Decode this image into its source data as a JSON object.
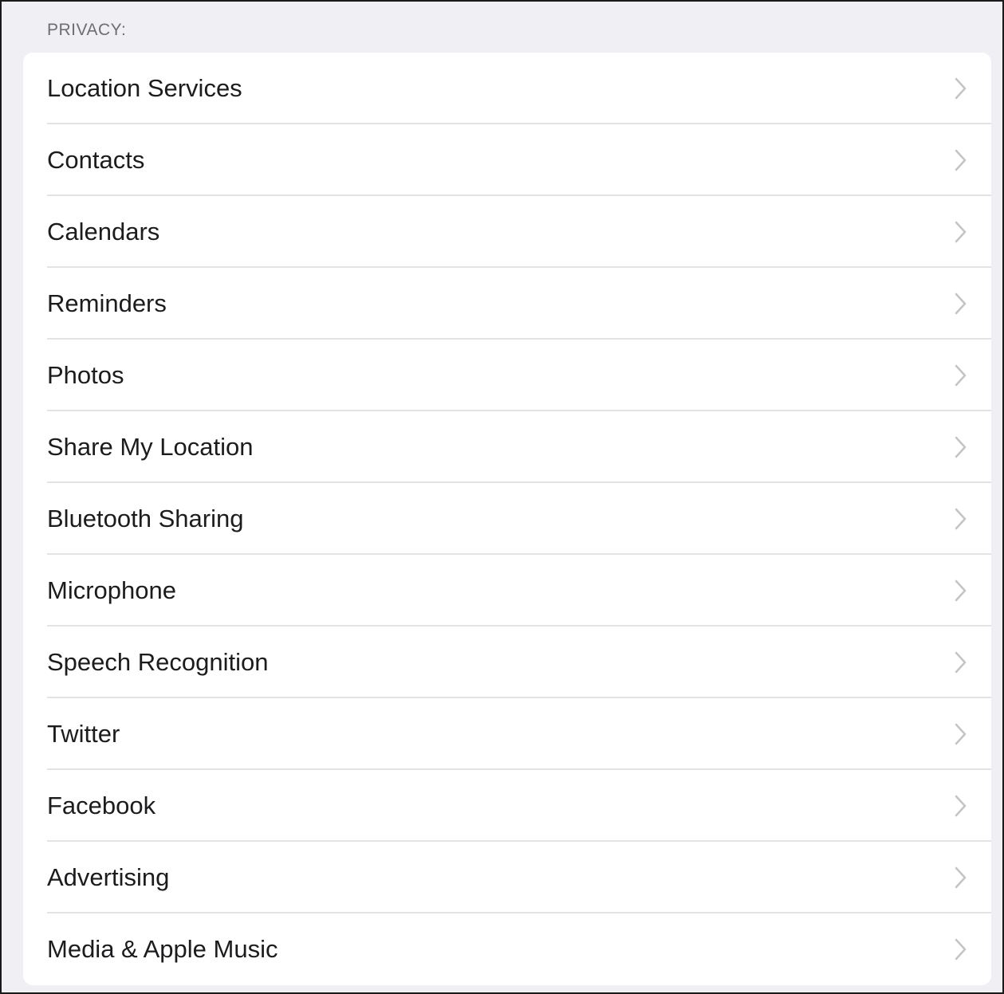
{
  "section": {
    "header": "PRIVACY:"
  },
  "rows": [
    {
      "label": "Location Services",
      "icon": "chevron-right-icon"
    },
    {
      "label": "Contacts",
      "icon": "chevron-right-icon"
    },
    {
      "label": "Calendars",
      "icon": "chevron-right-icon"
    },
    {
      "label": "Reminders",
      "icon": "chevron-right-icon"
    },
    {
      "label": "Photos",
      "icon": "chevron-right-icon"
    },
    {
      "label": "Share My Location",
      "icon": "chevron-right-icon"
    },
    {
      "label": "Bluetooth Sharing",
      "icon": "chevron-right-icon"
    },
    {
      "label": "Microphone",
      "icon": "chevron-right-icon"
    },
    {
      "label": "Speech Recognition",
      "icon": "chevron-right-icon"
    },
    {
      "label": "Twitter",
      "icon": "chevron-right-icon"
    },
    {
      "label": "Facebook",
      "icon": "chevron-right-icon"
    },
    {
      "label": "Advertising",
      "icon": "chevron-right-icon"
    },
    {
      "label": "Media & Apple Music",
      "icon": "chevron-right-icon"
    }
  ],
  "colors": {
    "background": "#efeff4",
    "row_background": "#ffffff",
    "label": "#1c1c1e",
    "header": "#6d6d72",
    "separator": "#e3e3e6",
    "chevron": "#c4c4c7"
  }
}
